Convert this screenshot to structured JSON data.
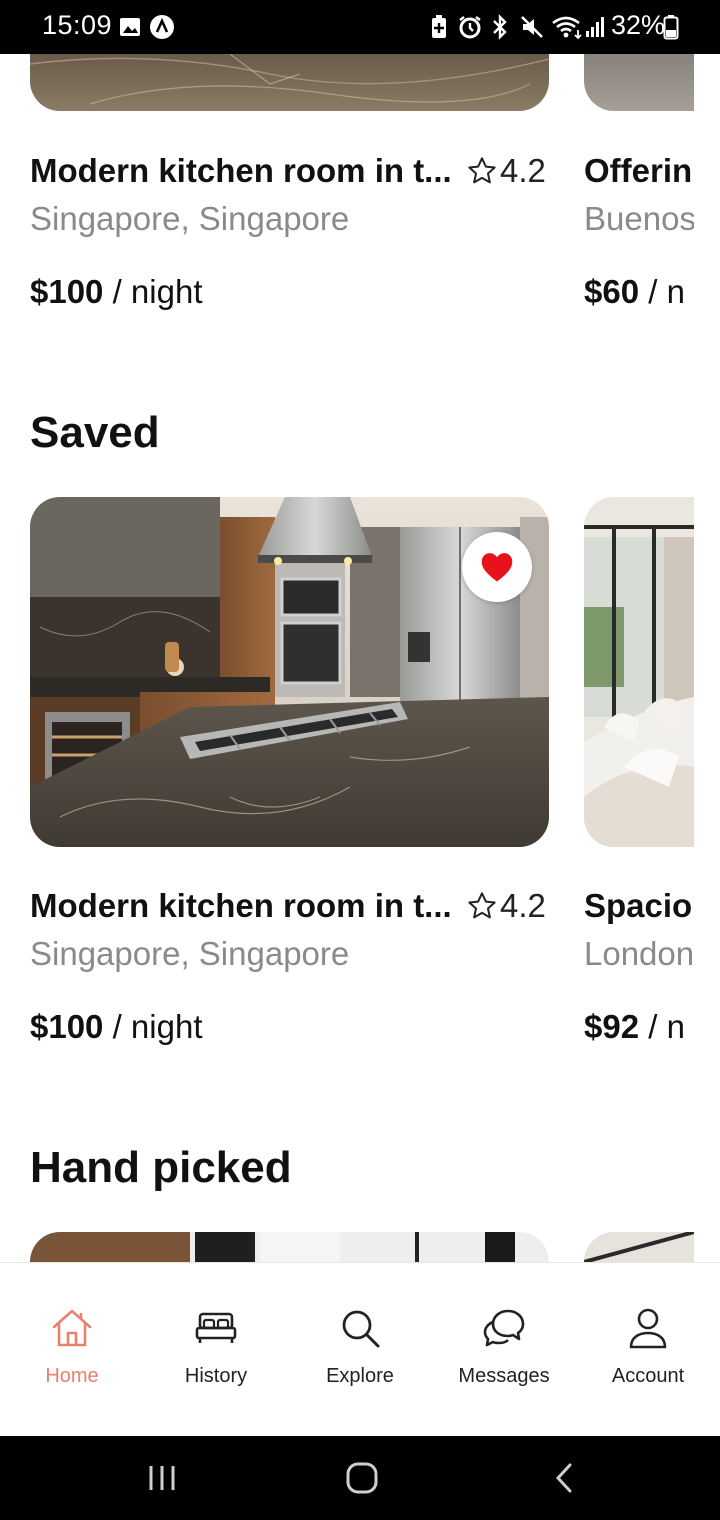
{
  "status_bar": {
    "time": "15:09",
    "battery_percent": "32%",
    "icons": [
      "gallery-icon",
      "app-notification-icon",
      "battery-saver-icon",
      "alarm-icon",
      "bluetooth-icon",
      "mute-icon",
      "wifi-icon",
      "signal-icon",
      "battery-icon"
    ]
  },
  "top_listings": [
    {
      "title": "Modern kitchen room in t...",
      "rating": "4.2",
      "location": "Singapore, Singapore",
      "price": "$100",
      "price_unit": "/ night"
    },
    {
      "title": "Offerin",
      "location": "Buenos",
      "price": "$60",
      "price_unit": "/ n"
    }
  ],
  "saved": {
    "heading": "Saved",
    "listings": [
      {
        "title": "Modern kitchen room in t...",
        "rating": "4.2",
        "location": "Singapore, Singapore",
        "price": "$100",
        "price_unit": "/ night",
        "favorited": true
      },
      {
        "title": "Spacio",
        "location": "London",
        "price": "$92",
        "price_unit": "/ n"
      }
    ]
  },
  "hand_picked": {
    "heading": "Hand picked"
  },
  "tabs": [
    {
      "label": "Home",
      "icon": "home-icon",
      "active": true
    },
    {
      "label": "History",
      "icon": "bed-icon",
      "active": false
    },
    {
      "label": "Explore",
      "icon": "search-icon",
      "active": false
    },
    {
      "label": "Messages",
      "icon": "chat-icon",
      "active": false
    },
    {
      "label": "Account",
      "icon": "user-icon",
      "active": false
    }
  ],
  "colors": {
    "accent": "#e8826e",
    "heart": "#e8121b",
    "muted_text": "#8a8a8a"
  }
}
